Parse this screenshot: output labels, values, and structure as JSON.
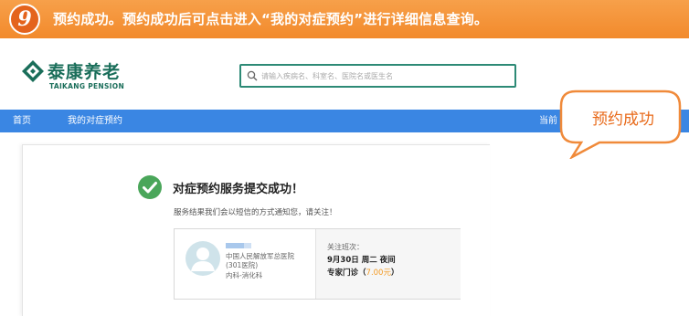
{
  "step": {
    "number": "9",
    "text": "预约成功。预约成功后可点击进入“我的对症预约”进行详细信息查询。"
  },
  "logo": {
    "cn": "泰康养老",
    "en": "TAIKANG PENSION"
  },
  "search": {
    "placeholder": "请输入疾病名、科室名、医院名或医生名"
  },
  "nav": {
    "items": [
      "首页",
      "我的对症预约"
    ],
    "right": "当前"
  },
  "callout": {
    "text": "预约成功"
  },
  "result": {
    "title": "对症预约服务提交成功！",
    "subtitle": "服务结果我们会以短信的方式通知您，请关注！"
  },
  "booking": {
    "hospital_line1": "中国人民解放军总医院",
    "hospital_line2": "(301医院)",
    "department": "内科-消化科",
    "shift_label": "关注班次：",
    "shift_value": "9月30日 周二 夜间",
    "clinic_type": "专家门诊",
    "price_open": "（",
    "price": "7.00元",
    "price_close": "）"
  },
  "colors": {
    "banner": "#f28a2c",
    "nav": "#3a86e3",
    "brand": "#1a6e5a",
    "success": "#4aa65a",
    "price": "#f39b24"
  }
}
